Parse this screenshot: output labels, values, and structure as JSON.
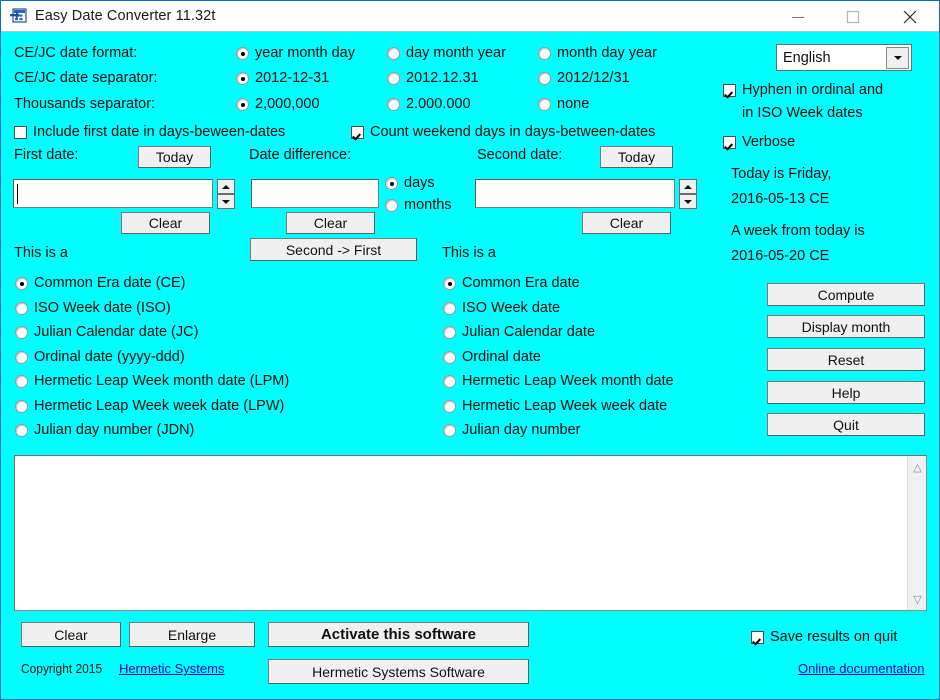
{
  "window": {
    "title": "Easy Date Converter 11.32t",
    "icon": "app-window-icon",
    "minimize": "minimize-icon",
    "maximize": "maximize-icon",
    "close": "close-icon",
    "background_color": "#00FFFF"
  },
  "settings": {
    "date_format": {
      "label": "CE/JC date format:",
      "options": [
        "year month day",
        "day month year",
        "month day year"
      ],
      "selected": 0
    },
    "date_separator": {
      "label": "CE/JC date separator:",
      "options": [
        "2012-12-31",
        "2012.12.31",
        "2012/12/31"
      ],
      "selected": 0
    },
    "thousands_separator": {
      "label": "Thousands separator:",
      "options": [
        "2,000,000",
        "2.000.000",
        "none"
      ],
      "selected": 0
    },
    "include_first_date": {
      "label": "Include first date in days-beween-dates",
      "checked": false
    },
    "count_weekend_days": {
      "label": "Count weekend days in days-between-dates",
      "checked": true
    }
  },
  "language": {
    "selected": "English",
    "dropdown_icon": "chevron-down-icon"
  },
  "options": {
    "hyphen": {
      "label_line1": "Hyphen in ordinal and",
      "label_line2": "in ISO Week dates",
      "checked": true
    },
    "verbose": {
      "label": "Verbose",
      "checked": true
    }
  },
  "today_info": {
    "line1": "Today is Friday,",
    "line2": "2016-05-13 CE",
    "line3": "A week from today is",
    "line4": "2016-05-20 CE"
  },
  "first_date": {
    "label": "First date:",
    "today_button": "Today",
    "value": "",
    "clear_button": "Clear",
    "this_is_a": "This is a"
  },
  "date_difference": {
    "label": "Date difference:",
    "value": "",
    "clear_button": "Clear",
    "units": [
      "days",
      "months"
    ],
    "units_selected": 0,
    "second_to_first_button": "Second -> First"
  },
  "second_date": {
    "label": "Second date:",
    "today_button": "Today",
    "value": "",
    "clear_button": "Clear",
    "this_is_a": "This is a"
  },
  "left_date_types": {
    "options": [
      "Common Era date (CE)",
      "ISO Week date (ISO)",
      "Julian Calendar date (JC)",
      "Ordinal date (yyyy-ddd)",
      "Hermetic Leap Week month date (LPM)",
      "Hermetic Leap Week week date (LPW)",
      "Julian day number (JDN)"
    ],
    "selected": 0
  },
  "right_date_types": {
    "options": [
      "Common Era date",
      "ISO Week date",
      "Julian Calendar date",
      "Ordinal date",
      "Hermetic Leap Week month date",
      "Hermetic Leap Week week date",
      "Julian day number"
    ],
    "selected": 0
  },
  "action_buttons": [
    "Compute",
    "Display month",
    "Reset",
    "Help",
    "Quit"
  ],
  "results": {
    "text": "",
    "scroll_up_icon": "chevron-up-icon",
    "scroll_down_icon": "chevron-down-icon"
  },
  "footer": {
    "clear_button": "Clear",
    "enlarge_button": "Enlarge",
    "activate_button": "Activate this software",
    "hermetic_button": "Hermetic Systems Software",
    "copyright_text": "Copyright 2015",
    "copyright_link": "Hermetic Systems",
    "save_results": {
      "label": "Save results on quit",
      "checked": true
    },
    "online_documentation": "Online documentation"
  }
}
